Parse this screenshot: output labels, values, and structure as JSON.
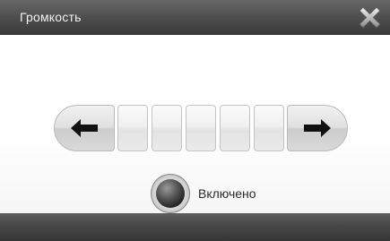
{
  "window": {
    "title": "Громкость",
    "close_icon": "close-x-icon"
  },
  "volume": {
    "decrease_icon": "arrow-left-icon",
    "increase_icon": "arrow-right-icon",
    "segments_total": 5,
    "segments_filled": 0
  },
  "toggle": {
    "label": "Включено",
    "icon": "round-toggle-knob"
  }
}
